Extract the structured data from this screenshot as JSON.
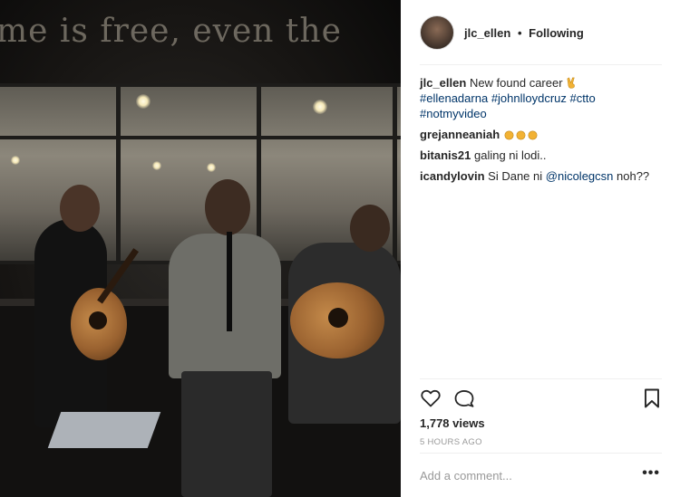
{
  "post": {
    "author": "jlc_ellen",
    "separator": "•",
    "follow_status": "Following",
    "wall_text": "me is free, even the",
    "caption": {
      "username": "jlc_ellen",
      "text": "New found career",
      "emoji": "v-hand-emoji",
      "hashtags": [
        "#ellenadarna",
        "#johnlloydcruz",
        "#ctto",
        "#notmyvideo"
      ]
    },
    "comments": [
      {
        "username": "grejanneaniah",
        "text": "",
        "emoji": "clapping-hands-x3"
      },
      {
        "username": "bitanis21",
        "text": "galing ni lodi.."
      },
      {
        "username": "icandylovin",
        "text_before": "Si Dane ni",
        "mention": "@nicolegcsn",
        "text_after": "noh??"
      }
    ],
    "views": "1,778 views",
    "timestamp": "5 HOURS AGO",
    "add_comment_placeholder": "Add a comment...",
    "more_options": "•••"
  },
  "icons": {
    "like": "heart-icon",
    "comment": "comment-icon",
    "save": "bookmark-icon"
  },
  "colors": {
    "link": "#003569",
    "text": "#262626",
    "muted": "#999999",
    "divider": "#efefef"
  }
}
